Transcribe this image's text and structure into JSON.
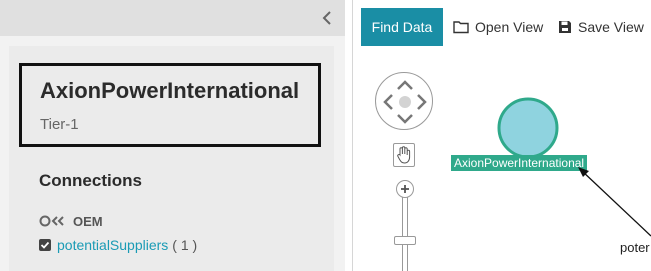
{
  "left_panel": {
    "entity": {
      "name": "AxionPowerInternational",
      "tier": "Tier-1"
    },
    "connections": {
      "title": "Connections",
      "oem_label": "OEM",
      "supplier_link": "potentialSuppliers",
      "supplier_count": "( 1 )"
    }
  },
  "toolbar": {
    "find_data": "Find Data",
    "open_view": "Open View",
    "save_view": "Save View"
  },
  "graph": {
    "node_label": "AxionPowerInternational",
    "edge_label": "poter",
    "node_color": "#8fd3df",
    "node_ring_color": "#2fa98b",
    "label_bg": "#2fa98b"
  },
  "icons": {
    "collapse": "chevron-left-icon",
    "open": "folder-icon",
    "save": "floppy-disk-icon",
    "pan": "hand-icon",
    "zoom_in": "plus-icon"
  },
  "colors": {
    "accent": "#1a8ea5",
    "link": "#1a9bb5"
  }
}
